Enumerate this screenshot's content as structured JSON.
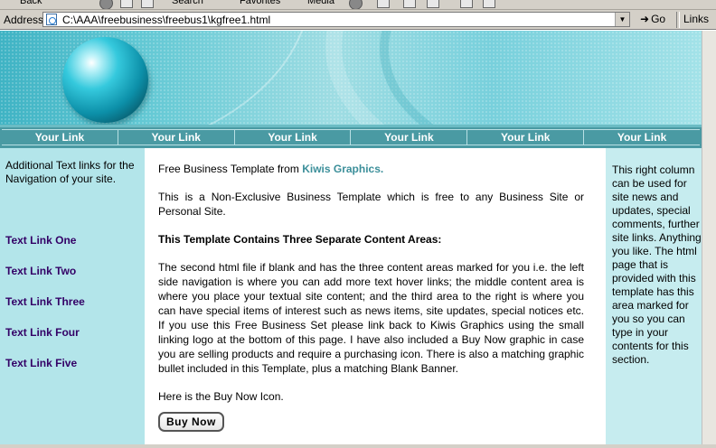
{
  "toolbar": {
    "back_label": "Back",
    "search_label": "Search",
    "favorites_label": "Favorites",
    "media_label": "Media"
  },
  "address_bar": {
    "label": "Address",
    "url": "C:\\AAA\\freebusiness\\freebus1\\kgfree1.html",
    "go_label": "Go",
    "links_label": "Links"
  },
  "nav": {
    "links": [
      "Your Link",
      "Your Link",
      "Your Link",
      "Your Link",
      "Your Link",
      "Your Link"
    ]
  },
  "left": {
    "intro": "Additional Text links for the Navigation of your site.",
    "links": [
      "Text Link One",
      "Text Link Two",
      "Text Link Three",
      "Text Link Four",
      "Text Link Five"
    ]
  },
  "main": {
    "intro_prefix": "Free Business Template from",
    "intro_link": "Kiwis Graphics",
    "intro_suffix": ".",
    "para1": "This is a Non-Exclusive Business Template which is free to any Business Site or Personal Site.",
    "heading": "This Template Contains Three Separate Content Areas:",
    "para2": "The second html file if blank and has the three content areas marked for you i.e. the left side navigation is where you can add more text hover links; the middle content area is where you place your textual site content; and the third area to the right is where you can have special items of interest such as news items, site updates, special notices etc. If you use this Free Business Set please link back to Kiwis Graphics using the small linking logo at the bottom of this page. I have also included a Buy Now graphic in case you are selling products and require a purchasing icon.  There is also a matching graphic bullet included in this Template, plus a matching Blank Banner.",
    "buy_intro": "Here is the Buy Now Icon.",
    "buy_button": "Buy Now"
  },
  "right": {
    "text": "This right column can be used for site news and updates, special comments, further site links. Anything you like. The html page that is provided with this template has this area marked for you so you can type in your contents for this section."
  },
  "colors": {
    "nav_bg": "#4a9aa3",
    "left_bg": "#b3e5ea",
    "right_bg": "#c6ecef",
    "left_link": "#330066",
    "accent_link": "#3c8f9a"
  }
}
